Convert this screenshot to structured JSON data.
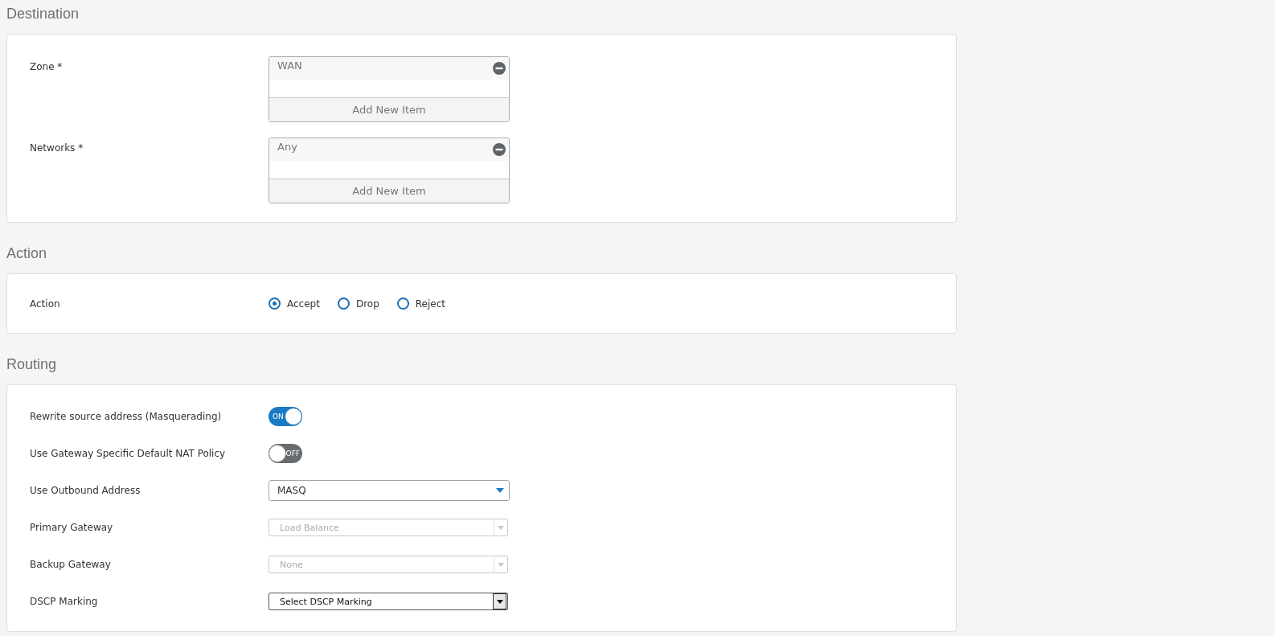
{
  "destination": {
    "title": "Destination",
    "fields": [
      {
        "label": "Zone *",
        "items": [
          "WAN"
        ],
        "add_label": "Add New Item"
      },
      {
        "label": "Networks *",
        "items": [
          "Any"
        ],
        "add_label": "Add New Item"
      }
    ]
  },
  "action": {
    "title": "Action",
    "label": "Action",
    "options": [
      {
        "label": "Accept",
        "selected": true
      },
      {
        "label": "Drop",
        "selected": false
      },
      {
        "label": "Reject",
        "selected": false
      }
    ]
  },
  "routing": {
    "title": "Routing",
    "rows": [
      {
        "kind": "toggle",
        "label": "Rewrite source address (Masquerading)",
        "on": true,
        "state_label": "ON"
      },
      {
        "kind": "toggle",
        "label": "Use Gateway Specific Default NAT Policy",
        "on": false,
        "state_label": "OFF"
      },
      {
        "kind": "dropdown",
        "label": "Use Outbound Address",
        "value": "MASQ"
      },
      {
        "kind": "select",
        "label": "Primary Gateway",
        "value": "Load Balance",
        "disabled": true
      },
      {
        "kind": "select",
        "label": "Backup Gateway",
        "value": "None",
        "disabled": true
      },
      {
        "kind": "select",
        "label": "DSCP Marking",
        "value": "Select DSCP Marking",
        "disabled": false
      }
    ]
  }
}
